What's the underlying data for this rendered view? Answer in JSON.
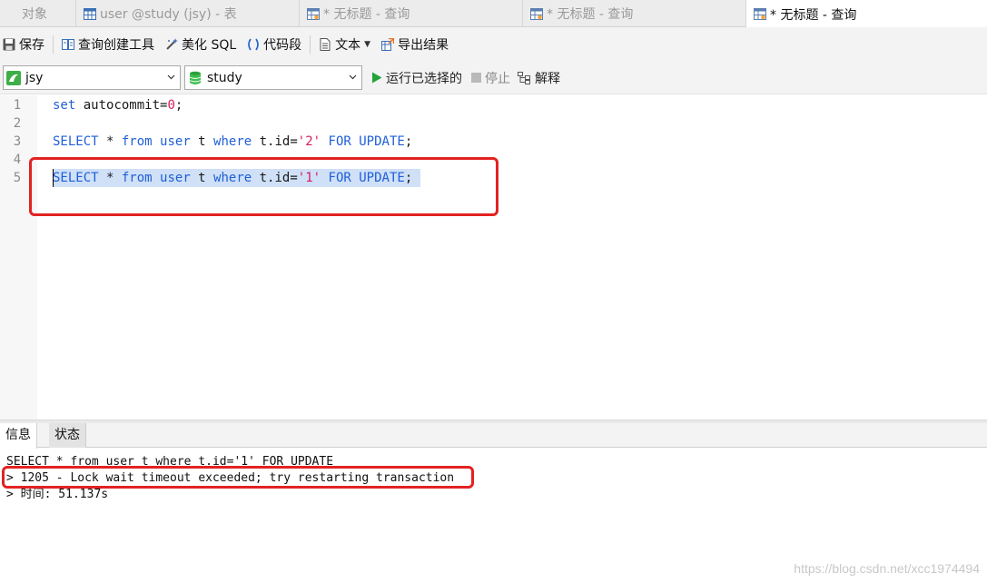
{
  "tabs": [
    {
      "label": "对象"
    },
    {
      "label": "user @study (jsy) - 表"
    },
    {
      "label": "* 无标题 - 查询"
    },
    {
      "label": "* 无标题 - 查询"
    },
    {
      "label": "* 无标题 - 查询"
    }
  ],
  "toolbar": {
    "save": "保存",
    "query_builder": "查询创建工具",
    "beautify": "美化 SQL",
    "snippet": "代码段",
    "text": "文本",
    "export": "导出结果"
  },
  "connection": {
    "connection_value": "jsy",
    "database_value": "study",
    "run_selected": "运行已选择的",
    "stop": "停止",
    "explain": "解释"
  },
  "editor": {
    "lines": [
      {
        "num": "1"
      },
      {
        "num": "2"
      },
      {
        "num": "3"
      },
      {
        "num": "4"
      },
      {
        "num": "5"
      }
    ],
    "l1_kw": "set",
    "l1_rest": " autocommit=",
    "l1_num": "0",
    "l1_end": ";",
    "l3_select": "SELECT",
    "l3_star": " * ",
    "l3_from": "from",
    "l3_user": "user",
    "l3_t": " t ",
    "l3_where": "where",
    "l3_cond": " t.id=",
    "l3_val": "'2'",
    "l3_for": "FOR UPDATE",
    "l3_end": ";",
    "l5_select": "SELECT",
    "l5_star": " * ",
    "l5_from": "from",
    "l5_user": "user",
    "l5_t": " t ",
    "l5_where": "where",
    "l5_cond": " t.id=",
    "l5_val": "'1'",
    "l5_for": "FOR UPDATE",
    "l5_end": ";"
  },
  "result_tabs": {
    "info": "信息",
    "status": "状态"
  },
  "output": {
    "line1": "SELECT * from user t where t.id='1' FOR UPDATE",
    "line2": "> 1205 - Lock wait timeout exceeded; try restarting transaction",
    "line3": "> 时间: 51.137s"
  },
  "watermark": "https://blog.csdn.net/xcc1974494",
  "colors": {
    "keyword": "#1f5fd6",
    "string": "#d81b60",
    "selection": "#cfe0f7",
    "highlight_box": "#e32222",
    "run_green": "#22a33a"
  }
}
